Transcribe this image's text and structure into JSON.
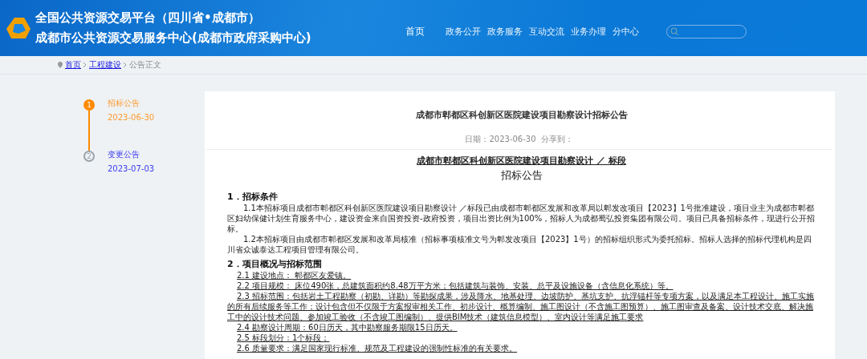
{
  "header": {
    "title_line_1": "全国公共资源交易平台（四川省•成都市）",
    "title_line_2": "成都市公共资源交易服务中心(成都市政府采购中心)",
    "nav": [
      {
        "label": "首页",
        "selected": true
      },
      {
        "label": "政务公开",
        "selected": false
      },
      {
        "label": "政务服务",
        "selected": false
      },
      {
        "label": "互动交流",
        "selected": false
      },
      {
        "label": "业务办理",
        "selected": false
      },
      {
        "label": "分中心",
        "selected": false
      }
    ]
  },
  "breadcrumb": [
    {
      "label": "首页",
      "link": true
    },
    {
      "label": "工程建设",
      "link": true
    },
    {
      "label": "公告正文",
      "link": false
    }
  ],
  "timeline": [
    {
      "number": "1",
      "title": "招标公告",
      "date": "2023-06-30",
      "selected": true
    },
    {
      "number": "2",
      "title": "变更公告",
      "date": "2023-07-03",
      "selected": false
    }
  ],
  "article": {
    "title": "成都市郫都区科创新区医院建设项目勘察设计招标公告",
    "date_label": "日期：2023-06-30",
    "share_label": "分享到：",
    "heading": "成都市郫都区科创新区医院建设项目勘察设计 ／ 标段",
    "subheading": "招标公告",
    "sections": [
      {
        "heading": "1．招标条件",
        "paragraphs": [
          {
            "kind": "indent",
            "text": "1.1本招标项目成都市郫都区科创新区医院建设项目勘察设计 ／标段已由成都市郫都区发展和改革局以郫发改项目【2023】1号批准建设，项目业主为成都市郫都区妇幼保健计划生育服务中心，建设资金来自国资投资-政府投资，项目出资比例为100%，招标人为成都蜀弘投资集团有限公司。项目已具备招标条件，现进行公开招标。"
          },
          {
            "kind": "indent",
            "text": "1.2本招标项目由成都市郫都区发展和改革局核准（招标事项核准文号为郫发改项目【2023】1号）的招标组织形式为委托招标。招标人选择的招标代理机构是四川省众诚泰达工程项目管理有限公司。"
          }
        ]
      },
      {
        "heading": "2．项目概况与招标范围",
        "paragraphs": [
          {
            "kind": "underlined",
            "text": "2.1 建设地点： 郫都区友爱镇。"
          },
          {
            "kind": "underlined",
            "text": "2.2 项目规模： 床位490张，总建筑面积约8.48万平方米；包括建筑与装饰、安装、总平及设施设备（含信息化系统）等。"
          },
          {
            "kind": "underlined",
            "text": "2.3 招标范围：包括岩土工程勘察（初勘、详勘）等勘探成果，涉及降水、地基处理、边坡防护、基坑支护、抗浮锚杆等专项方案，以及满足本工程设计、施工实施的所有后续服务等工作；设计包含但不仅限于方案报审相关工作、初步设计、概算编制、施工图设计（不含施工图预算）、施工图审查及备案、设计技术交底、解决施工中的设计技术问题、参加竣工验收（不含竣工图编制）、提供BIM技术（建筑信息模型）、室内设计等满足施工要求"
          },
          {
            "kind": "underlined",
            "text": "2.4 勘察设计周期：60日历天，其中勘察服务期限15日历天。"
          },
          {
            "kind": "underlined",
            "text": "2.5 标段划分：1个标段；"
          },
          {
            "kind": "underlined",
            "text": "2.6 质量要求：满足国家现行标准、规范及工程建设的强制性标准的有关要求。"
          }
        ]
      }
    ]
  }
}
